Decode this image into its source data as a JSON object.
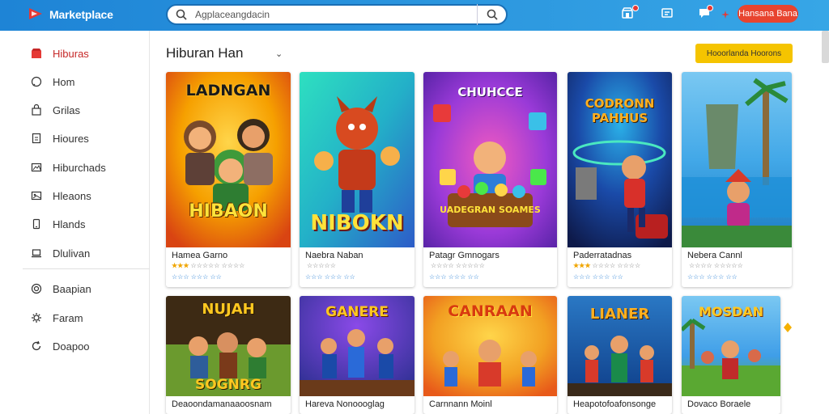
{
  "app": {
    "name": "Marketplace"
  },
  "search": {
    "placeholder": "Agplaceangdacin"
  },
  "header": {
    "cta_label": "Hansana Bana"
  },
  "sidebar": {
    "items": [
      {
        "label": "Hiburas",
        "icon": "store-icon",
        "active": true
      },
      {
        "label": "Hom",
        "icon": "chat-icon"
      },
      {
        "label": "Grilas",
        "icon": "bag-icon"
      },
      {
        "label": "Hioures",
        "icon": "document-icon"
      },
      {
        "label": "Hiburchads",
        "icon": "image-icon"
      },
      {
        "label": "Hleaons",
        "icon": "image-icon"
      },
      {
        "label": "Hlands",
        "icon": "phone-icon"
      },
      {
        "label": "Dlulivan",
        "icon": "laptop-icon"
      }
    ],
    "secondary": [
      {
        "label": "Baapian",
        "icon": "target-icon"
      },
      {
        "label": "Faram",
        "icon": "gear-icon"
      },
      {
        "label": "Doapoo",
        "icon": "refresh-icon"
      }
    ]
  },
  "main": {
    "section_title": "Hiburan Han",
    "filter_button": "Hooorlanda Hoorons",
    "row1": [
      {
        "art_title": "LADNGAN",
        "art_subtitle": "HIBAON",
        "title": "Hamea Garno",
        "stars": "★★★",
        "rating_text": "☆☆☆☆☆ ☆☆☆☆",
        "meta": "☆☆☆ ☆☆☆ ☆☆",
        "palette": [
          "#f6a000",
          "#d94412"
        ]
      },
      {
        "art_title": "",
        "art_subtitle": "NIBOKN",
        "title": "Naebra Naban",
        "stars": "",
        "rating_text": "☆☆☆☆☆",
        "meta": "☆☆☆ ☆☆☆ ☆☆",
        "palette": [
          "#23b0c8",
          "#2d5cc8"
        ]
      },
      {
        "art_title": "CHUHCCE",
        "art_subtitle": "UADEGRAN SOAMES",
        "title": "Patagr Gmnogars",
        "stars": "",
        "rating_text": "☆☆☆☆ ☆☆☆☆☆",
        "meta": "☆☆☆ ☆☆☆ ☆☆",
        "palette": [
          "#7a36d0",
          "#d03a9e"
        ]
      },
      {
        "art_title": "CODRONN PAHHUS",
        "art_subtitle": "",
        "title": "Paderratadnas",
        "stars": "★★★",
        "rating_text": "☆☆☆☆ ☆☆☆☆",
        "meta": "☆☆☆ ☆☆☆ ☆☆",
        "palette": [
          "#1a2c74",
          "#0e5ea8"
        ]
      },
      {
        "art_title": "",
        "art_subtitle": "",
        "title": "Nebera Cannl",
        "stars": "",
        "rating_text": "☆☆☆☆ ☆☆☆☆☆",
        "meta": "☆☆☆ ☆☆☆ ☆☆",
        "palette": [
          "#42a8e8",
          "#2a8a5e"
        ]
      }
    ],
    "row2": [
      {
        "art_title": "NUJAH",
        "art_subtitle": "SOGNRG",
        "title": "Deaoondamanaaoosnam",
        "palette": [
          "#3d2a14",
          "#6b9a2e"
        ]
      },
      {
        "art_title": "GANERE",
        "art_subtitle": "",
        "title": "Hareva Nonoooglag",
        "palette": [
          "#2b2f8f",
          "#6a2aa8"
        ]
      },
      {
        "art_title": "CANRAAN",
        "art_subtitle": "",
        "title": "Carnnann Moinl",
        "palette": [
          "#e85a1a",
          "#f2a022"
        ]
      },
      {
        "art_title": "LIANER",
        "art_subtitle": "",
        "title": "Heapotofoafonsonge",
        "palette": [
          "#0f3f8a",
          "#2a78c4"
        ]
      },
      {
        "art_title": "MOSDAN",
        "art_subtitle": "",
        "title": "Dovaco Boraele",
        "palette": [
          "#3f9ee8",
          "#5aa832"
        ]
      }
    ]
  },
  "colors": {
    "topbar": "#1e84d6",
    "accent_red": "#e8442f",
    "accent_yellow": "#f5c400",
    "active_red": "#c62828"
  }
}
